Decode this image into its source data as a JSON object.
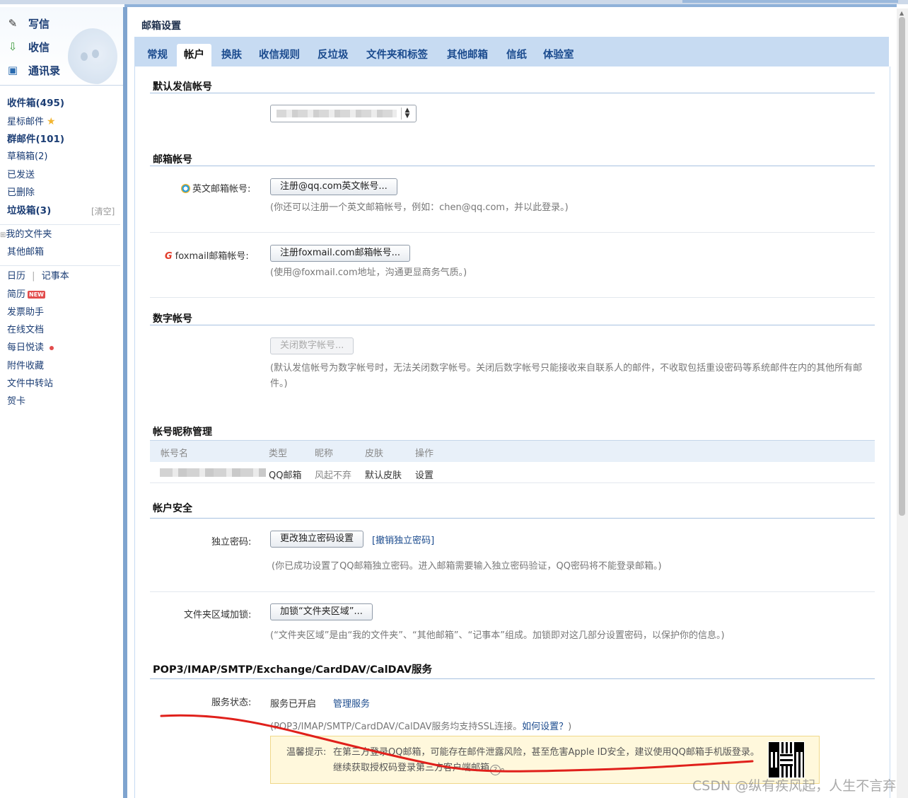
{
  "sidebar": {
    "compose": [
      {
        "label": "写信",
        "icon": "pen-icon"
      },
      {
        "label": "收信",
        "icon": "inbox-download-icon"
      },
      {
        "label": "通讯录",
        "icon": "contacts-icon"
      }
    ],
    "folders": {
      "inbox": "收件箱(495)",
      "starred": "星标邮件",
      "group": "群邮件(101)",
      "drafts": "草稿箱(2)",
      "sent": "已发送",
      "deleted": "已删除",
      "spam": "垃圾箱(3)",
      "spam_clear": "[清空]",
      "my_folders": "我的文件夹",
      "other_mail": "其他邮箱"
    },
    "apps": {
      "calendar": "日历",
      "divider": "|",
      "notes": "记事本",
      "resume": "简历",
      "resume_badge": "NEW",
      "invoice": "发票助手",
      "online_docs": "在线文档",
      "daily_read": "每日悦读",
      "attachments": "附件收藏",
      "file_transfer": "文件中转站",
      "cards": "贺卡"
    }
  },
  "header": {
    "title": "邮箱设置",
    "tabs": [
      "常规",
      "帐户",
      "换肤",
      "收信规则",
      "反垃圾",
      "文件夹和标签",
      "其他邮箱",
      "信纸",
      "体验室"
    ],
    "active_tab": "帐户"
  },
  "default_sender": {
    "title": "默认发信帐号"
  },
  "mail_accounts": {
    "title": "邮箱帐号",
    "english_label": "英文邮箱帐号:",
    "english_button": "注册@qq.com英文帐号...",
    "english_hint": "(你还可以注册一个英文邮箱帐号，例如：chen@qq.com，并以此登录。)",
    "foxmail_label": "foxmail邮箱帐号:",
    "foxmail_button": "注册foxmail.com邮箱帐号...",
    "foxmail_hint": "(使用@foxmail.com地址，沟通更显商务气质。)"
  },
  "digital_account": {
    "title": "数字帐号",
    "button": "关闭数字帐号...",
    "hint": "(默认发信帐号为数字帐号时，无法关闭数字帐号。关闭后数字帐号只能接收来自联系人的邮件，不收取包括重设密码等系统邮件在内的其他所有邮件。)"
  },
  "nickname": {
    "title": "帐号昵称管理",
    "columns": [
      "帐号名",
      "类型",
      "昵称",
      "皮肤",
      "操作"
    ],
    "row": {
      "type": "QQ邮箱",
      "nickname": "风起不弃",
      "skin": "默认皮肤",
      "action": "设置"
    }
  },
  "security": {
    "title": "帐户安全",
    "pwd_label": "独立密码:",
    "pwd_button": "更改独立密码设置",
    "pwd_cancel": "[撤销独立密码]",
    "pwd_hint": "(你已成功设置了QQ邮箱独立密码。进入邮箱需要输入独立密码验证，QQ密码将不能登录邮箱。)",
    "lock_label": "文件夹区域加锁:",
    "lock_button": "加锁“文件夹区域”...",
    "lock_hint": "(“文件夹区域”是由“我的文件夹”、“其他邮箱”、“记事本”组成。加锁即对这几部分设置密码，以保护你的信息。)"
  },
  "services": {
    "title": "POP3/IMAP/SMTP/Exchange/CardDAV/CalDAV服务",
    "status_label": "服务状态:",
    "status_value": "服务已开启",
    "manage_link": "管理服务",
    "ssl_hint": "(POP3/IMAP/SMTP/CardDAV/CalDAV服务均支持SSL连接。",
    "how_link": "如何设置？",
    "ssl_hint_end": ")",
    "warn_prefix": "温馨提示:",
    "warn_line1": "在第三方登录QQ邮箱，可能存在邮件泄露风险，甚至危害Apple ID安全，建议使用QQ邮箱手机版登录。",
    "warn_line2": "继续获取授权码登录第三方客户端邮箱",
    "help_glyph": "?",
    "warn_end": "。"
  },
  "watermark": "CSDN @纵有疾风起，人生不言弃",
  "colors": {
    "tab_bar": "#c7dbf2",
    "link": "#1b4b8e",
    "annotation_red": "#e0201b"
  }
}
